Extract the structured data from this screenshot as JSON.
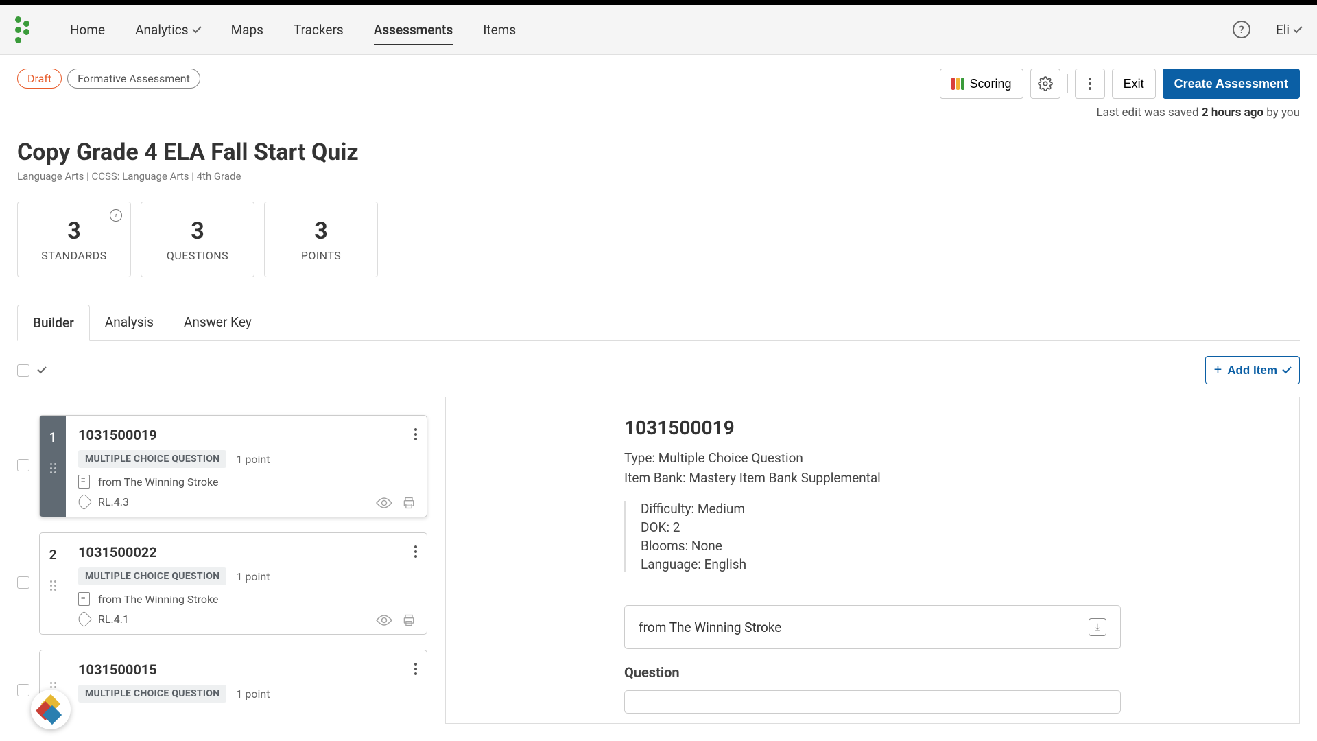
{
  "nav": {
    "items": [
      "Home",
      "Analytics",
      "Maps",
      "Trackers",
      "Assessments",
      "Items"
    ],
    "activeIndex": 4,
    "user": "Eli"
  },
  "badges": {
    "draft": "Draft",
    "type": "Formative Assessment"
  },
  "actions": {
    "scoring": "Scoring",
    "exit": "Exit",
    "create": "Create Assessment"
  },
  "lastEdit": {
    "prefix": "Last edit was saved ",
    "time": "2 hours ago",
    "suffix": " by you"
  },
  "title": "Copy Grade 4 ELA Fall Start Quiz",
  "meta": "Language Arts  |  CCSS: Language Arts  |  4th Grade",
  "stats": [
    {
      "value": "3",
      "label": "STANDARDS",
      "info": true
    },
    {
      "value": "3",
      "label": "QUESTIONS",
      "info": false
    },
    {
      "value": "3",
      "label": "POINTS",
      "info": false
    }
  ],
  "tabs": [
    "Builder",
    "Analysis",
    "Answer Key"
  ],
  "activeTab": 0,
  "addItem": "Add Item",
  "items": [
    {
      "num": "1",
      "id": "1031500019",
      "type": "MULTIPLE CHOICE QUESTION",
      "points": "1 point",
      "passage": "from The Winning Stroke",
      "standard": "RL.4.3",
      "selected": true
    },
    {
      "num": "2",
      "id": "1031500022",
      "type": "MULTIPLE CHOICE QUESTION",
      "points": "1 point",
      "passage": "from The Winning Stroke",
      "standard": "RL.4.1",
      "selected": false
    },
    {
      "num": "",
      "id": "1031500015",
      "type": "MULTIPLE CHOICE QUESTION",
      "points": "1 point",
      "passage": "",
      "standard": "",
      "selected": false
    }
  ],
  "detail": {
    "id": "1031500019",
    "typeLabel": "Type: Multiple Choice Question",
    "bankLabel": "Item Bank: Mastery Item Bank Supplemental",
    "difficulty": "Difficulty: Medium",
    "dok": "DOK: 2",
    "blooms": "Blooms: None",
    "language": "Language: English",
    "passage": "from The Winning Stroke",
    "questionHeading": "Question"
  }
}
